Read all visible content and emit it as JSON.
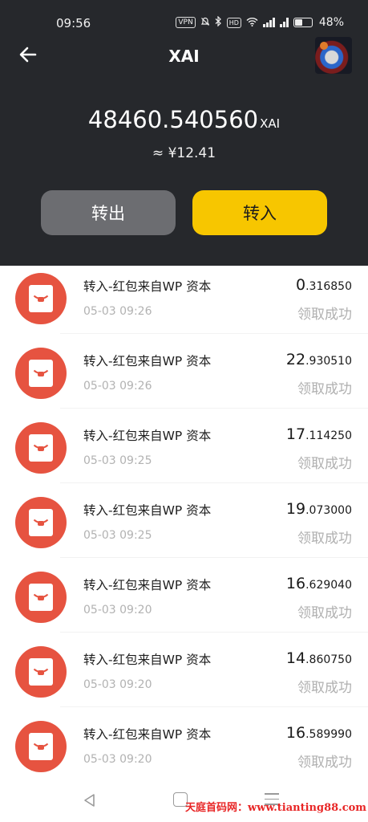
{
  "status_bar": {
    "time": "09:56",
    "vpn": "VPN",
    "hd": "HD",
    "battery": "48%"
  },
  "header": {
    "title": "XAI",
    "back_icon": "arrow-left-icon"
  },
  "balance": {
    "amount": "48460.540560",
    "unit": "XAI",
    "approx": "≈ ¥12.41"
  },
  "actions": {
    "transfer_out": "转出",
    "transfer_in": "转入"
  },
  "transactions": [
    {
      "title": "转入-红包来自WP 资本",
      "date": "05-03 09:26",
      "amount_int": "0",
      "amount_dec": ".316850",
      "status": "领取成功"
    },
    {
      "title": "转入-红包来自WP 资本",
      "date": "05-03 09:26",
      "amount_int": "22",
      "amount_dec": ".930510",
      "status": "领取成功"
    },
    {
      "title": "转入-红包来自WP 资本",
      "date": "05-03 09:25",
      "amount_int": "17",
      "amount_dec": ".114250",
      "status": "领取成功"
    },
    {
      "title": "转入-红包来自WP 资本",
      "date": "05-03 09:25",
      "amount_int": "19",
      "amount_dec": ".073000",
      "status": "领取成功"
    },
    {
      "title": "转入-红包来自WP 资本",
      "date": "05-03 09:20",
      "amount_int": "16",
      "amount_dec": ".629040",
      "status": "领取成功"
    },
    {
      "title": "转入-红包来自WP 资本",
      "date": "05-03 09:20",
      "amount_int": "14",
      "amount_dec": ".860750",
      "status": "领取成功"
    },
    {
      "title": "转入-红包来自WP 资本",
      "date": "05-03 09:20",
      "amount_int": "16",
      "amount_dec": ".589990",
      "status": "领取成功"
    }
  ],
  "watermark": "天庭首码网：www.tianting88.com",
  "colors": {
    "header_bg": "#26282c",
    "transfer_in_bg": "#f7c600",
    "transfer_out_bg": "#6c6d71",
    "red_packet": "#e65340"
  }
}
